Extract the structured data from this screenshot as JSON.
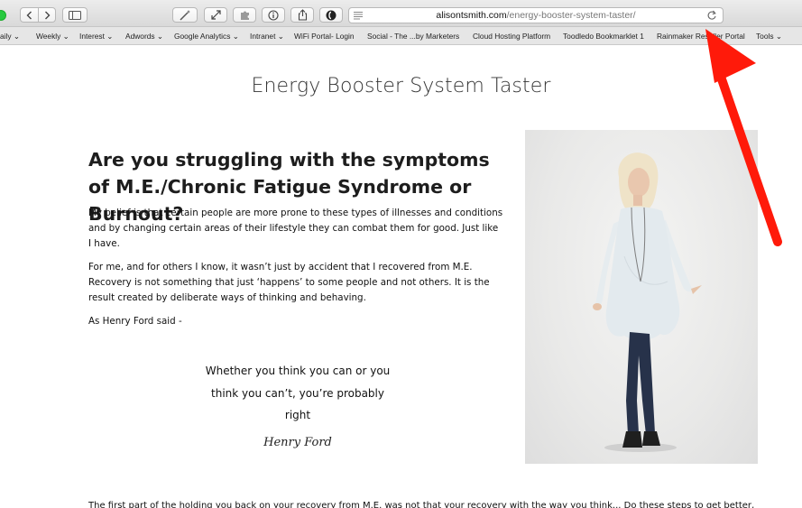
{
  "browser": {
    "url_host": "alisontsmith.com",
    "url_path": "/energy-booster-system-taster/"
  },
  "bookmarks": [
    "aily ⌄",
    "Weekly ⌄",
    "Interest ⌄",
    "Adwords ⌄",
    "Google Analytics ⌄",
    "Intranet ⌄",
    "WiFi Portal- Login",
    "Social - The ...by Marketers",
    "Cloud Hosting Platform",
    "Toodledo Bookmarklet 1",
    "Rainmaker Reseller Portal",
    "Tools ⌄"
  ],
  "page": {
    "title": "Energy Booster System Taster",
    "headline": "Are you struggling with the symptoms of M.E./Chronic Fatigue Syndrome or Burnout?",
    "paragraphs": [
      "My belief is that certain people are more prone to these types of illnesses and conditions and by changing certain areas of their lifestyle they can combat them for good. Just like I have.",
      "For me, and for others I know, it wasn’t just by accident that I recovered from M.E. Recovery is not something that just ‘happens’ to some people and not others. It is the result created by deliberate ways of thinking and behaving.",
      "As Henry Ford said -"
    ],
    "quote_lines": [
      "Whether you think you can or you",
      "think you can’t, you’re probably",
      "right"
    ],
    "quote_author": "Henry Ford",
    "bottom_text": "The first part of the holding you back on your recovery from M.E. was not that your recovery with the way you think... Do these steps to get better, the work. JUST"
  },
  "colors": {
    "annotation_arrow": "#ff1a0a",
    "toolbar": "#e0e0e0",
    "bookmarks_bar": "#e6e6e6"
  },
  "icons": [
    "back-icon",
    "forward-icon",
    "sidebar-icon",
    "magic-wand-icon",
    "fullscreen-icon",
    "puzzle-icon",
    "info-icon",
    "share-icon",
    "shield-icon",
    "reader-icon",
    "reload-icon"
  ]
}
